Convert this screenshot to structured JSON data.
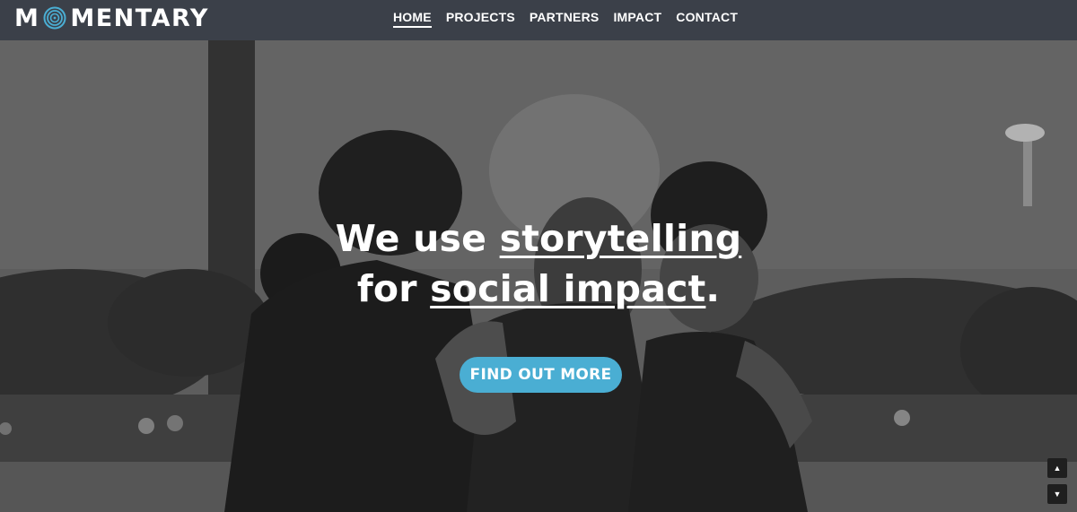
{
  "brand": {
    "logo_letters_before": "M",
    "logo_letters_after": "MENTARY",
    "accent_color": "#4aaed3"
  },
  "nav": {
    "items": [
      {
        "label": "HOME",
        "active": true
      },
      {
        "label": "PROJECTS",
        "active": false
      },
      {
        "label": "PARTNERS",
        "active": false
      },
      {
        "label": "IMPACT",
        "active": false
      },
      {
        "label": "CONTACT",
        "active": false
      }
    ]
  },
  "hero": {
    "line1_prefix": "We use ",
    "line1_emphasis": "storytelling",
    "line2_prefix": "for ",
    "line2_emphasis": "social impact",
    "line2_suffix": ".",
    "cta_label": "FIND OUT MORE"
  },
  "scroll": {
    "up_icon": "▲",
    "down_icon": "▼"
  }
}
